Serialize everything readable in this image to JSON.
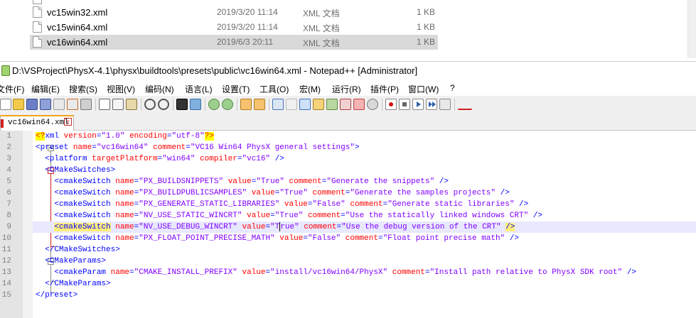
{
  "explorer": {
    "files": [
      {
        "name": "",
        "date": "",
        "type": "",
        "size": ""
      },
      {
        "name": "vc15win32.xml",
        "date": "2019/3/20 11:14",
        "type": "XML 文档",
        "size": "1 KB"
      },
      {
        "name": "vc15win64.xml",
        "date": "2019/3/20 11:14",
        "type": "XML 文档",
        "size": "1 KB"
      },
      {
        "name": "vc16win64.xml",
        "date": "2019/6/3 20:11",
        "type": "XML 文档",
        "size": "1 KB"
      }
    ]
  },
  "window": {
    "title": "D:\\VSProject\\PhysX-4.1\\physx\\buildtools\\presets\\public\\vc16win64.xml - Notepad++ [Administrator]"
  },
  "menu": [
    "文件(F)",
    "编辑(E)",
    "搜索(S)",
    "视图(V)",
    "编码(N)",
    "语言(L)",
    "设置(T)",
    "工具(O)",
    "宏(M)",
    "运行(R)",
    "插件(P)",
    "窗口(W)",
    "?"
  ],
  "toolbar_icons": [
    "new-file-icon",
    "open-file-icon",
    "save-icon",
    "save-all-icon",
    "close-icon",
    "close-all-icon",
    "print-icon",
    "cut-icon",
    "copy-icon",
    "paste-icon",
    "undo-icon",
    "redo-icon",
    "find-icon",
    "replace-icon",
    "zoom-in-icon",
    "zoom-out-icon",
    "sync-v-icon",
    "sync-h-icon",
    "wrap-icon",
    "all-chars-icon",
    "indent-guide-icon",
    "lang-icon",
    "doc-map-icon",
    "function-list-icon",
    "folder-workspace-icon",
    "monitor-icon",
    "record-macro-icon",
    "stop-macro-icon",
    "play-macro-icon",
    "run-macro-multiple-icon",
    "save-macro-icon",
    "spellcheck-icon"
  ],
  "tab": {
    "label": "vc16win64.xml"
  },
  "editor": {
    "line_numbers": [
      "1",
      "2",
      "3",
      "4",
      "5",
      "6",
      "7",
      "8",
      "9",
      "10",
      "11",
      "12",
      "13",
      "14",
      "15"
    ],
    "highlighted_line": 9,
    "lines": [
      {
        "indent": "",
        "parts": [
          {
            "c": "pi",
            "t": "<?"
          },
          {
            "c": "t",
            "t": "xml "
          },
          {
            "c": "a",
            "t": "version"
          },
          {
            "c": "t",
            "t": "="
          },
          {
            "c": "v",
            "t": "\"1.0\""
          },
          {
            "c": "t",
            "t": " "
          },
          {
            "c": "a",
            "t": "encoding"
          },
          {
            "c": "t",
            "t": "="
          },
          {
            "c": "v",
            "t": "\"utf-8\""
          },
          {
            "c": "pi",
            "t": "?>"
          }
        ]
      },
      {
        "indent": "",
        "parts": [
          {
            "c": "t",
            "t": "<preset "
          },
          {
            "c": "a",
            "t": "name"
          },
          {
            "c": "t",
            "t": "="
          },
          {
            "c": "v",
            "t": "\"vc16win64\""
          },
          {
            "c": "t",
            "t": " "
          },
          {
            "c": "a",
            "t": "comment"
          },
          {
            "c": "t",
            "t": "="
          },
          {
            "c": "v",
            "t": "\"VC16 Win64 PhysX general settings\""
          },
          {
            "c": "t",
            "t": ">"
          }
        ]
      },
      {
        "indent": "  ",
        "parts": [
          {
            "c": "t",
            "t": "<platform "
          },
          {
            "c": "a",
            "t": "targetPlatform"
          },
          {
            "c": "t",
            "t": "="
          },
          {
            "c": "v",
            "t": "\"win64\""
          },
          {
            "c": "t",
            "t": " "
          },
          {
            "c": "a",
            "t": "compiler"
          },
          {
            "c": "t",
            "t": "="
          },
          {
            "c": "v",
            "t": "\"vc16\""
          },
          {
            "c": "t",
            "t": " />"
          }
        ]
      },
      {
        "indent": "  ",
        "parts": [
          {
            "c": "t",
            "t": "<CMakeSwitches>"
          }
        ]
      },
      {
        "indent": "    ",
        "parts": [
          {
            "c": "t",
            "t": "<cmakeSwitch "
          },
          {
            "c": "a",
            "t": "name"
          },
          {
            "c": "t",
            "t": "="
          },
          {
            "c": "v",
            "t": "\"PX_BUILDSNIPPETS\""
          },
          {
            "c": "t",
            "t": " "
          },
          {
            "c": "a",
            "t": "value"
          },
          {
            "c": "t",
            "t": "="
          },
          {
            "c": "v",
            "t": "\"True\""
          },
          {
            "c": "t",
            "t": " "
          },
          {
            "c": "a",
            "t": "comment"
          },
          {
            "c": "t",
            "t": "="
          },
          {
            "c": "v",
            "t": "\"Generate the snippets\""
          },
          {
            "c": "t",
            "t": " />"
          }
        ]
      },
      {
        "indent": "    ",
        "parts": [
          {
            "c": "t",
            "t": "<cmakeSwitch "
          },
          {
            "c": "a",
            "t": "name"
          },
          {
            "c": "t",
            "t": "="
          },
          {
            "c": "v",
            "t": "\"PX_BUILDPUBLICSAMPLES\""
          },
          {
            "c": "t",
            "t": " "
          },
          {
            "c": "a",
            "t": "value"
          },
          {
            "c": "t",
            "t": "="
          },
          {
            "c": "v",
            "t": "\"True\""
          },
          {
            "c": "t",
            "t": " "
          },
          {
            "c": "a",
            "t": "comment"
          },
          {
            "c": "t",
            "t": "="
          },
          {
            "c": "v",
            "t": "\"Generate the samples projects\""
          },
          {
            "c": "t",
            "t": " />"
          }
        ]
      },
      {
        "indent": "    ",
        "parts": [
          {
            "c": "t",
            "t": "<cmakeSwitch "
          },
          {
            "c": "a",
            "t": "name"
          },
          {
            "c": "t",
            "t": "="
          },
          {
            "c": "v",
            "t": "\"PX_GENERATE_STATIC_LIBRARIES\""
          },
          {
            "c": "t",
            "t": " "
          },
          {
            "c": "a",
            "t": "value"
          },
          {
            "c": "t",
            "t": "="
          },
          {
            "c": "v",
            "t": "\"False\""
          },
          {
            "c": "t",
            "t": " "
          },
          {
            "c": "a",
            "t": "comment"
          },
          {
            "c": "t",
            "t": "="
          },
          {
            "c": "v",
            "t": "\"Generate static libraries\""
          },
          {
            "c": "t",
            "t": " />"
          }
        ]
      },
      {
        "indent": "    ",
        "parts": [
          {
            "c": "t",
            "t": "<cmakeSwitch "
          },
          {
            "c": "a",
            "t": "name"
          },
          {
            "c": "t",
            "t": "="
          },
          {
            "c": "v",
            "t": "\"NV_USE_STATIC_WINCRT\""
          },
          {
            "c": "t",
            "t": " "
          },
          {
            "c": "a",
            "t": "value"
          },
          {
            "c": "t",
            "t": "="
          },
          {
            "c": "v",
            "t": "\"True\""
          },
          {
            "c": "t",
            "t": " "
          },
          {
            "c": "a",
            "t": "comment"
          },
          {
            "c": "t",
            "t": "="
          },
          {
            "c": "v",
            "t": "\"Use the statically linked windows CRT\""
          },
          {
            "c": "t",
            "t": " />"
          }
        ]
      },
      {
        "indent": "    ",
        "parts": [
          {
            "c": "t hl-tag",
            "t": "<cmakeSwitch"
          },
          {
            "c": "t",
            "t": " "
          },
          {
            "c": "a",
            "t": "name"
          },
          {
            "c": "t",
            "t": "="
          },
          {
            "c": "v",
            "t": "\"NV_USE_DEBUG_WINCRT\""
          },
          {
            "c": "t",
            "t": " "
          },
          {
            "c": "a",
            "t": "value"
          },
          {
            "c": "t",
            "t": "="
          },
          {
            "c": "v",
            "t": "\"T"
          },
          {
            "c": "caret",
            "t": ""
          },
          {
            "c": "v",
            "t": "rue\""
          },
          {
            "c": "t",
            "t": " "
          },
          {
            "c": "a",
            "t": "comment"
          },
          {
            "c": "t",
            "t": "="
          },
          {
            "c": "v",
            "t": "\"Use the debug version of the CRT\""
          },
          {
            "c": "t",
            "t": " "
          },
          {
            "c": "t hl-tag",
            "t": "/>"
          }
        ]
      },
      {
        "indent": "    ",
        "parts": [
          {
            "c": "t",
            "t": "<cmakeSwitch "
          },
          {
            "c": "a",
            "t": "name"
          },
          {
            "c": "t",
            "t": "="
          },
          {
            "c": "v",
            "t": "\"PX_FLOAT_POINT_PRECISE_MATH\""
          },
          {
            "c": "t",
            "t": " "
          },
          {
            "c": "a",
            "t": "value"
          },
          {
            "c": "t",
            "t": "="
          },
          {
            "c": "v",
            "t": "\"False\""
          },
          {
            "c": "t",
            "t": " "
          },
          {
            "c": "a",
            "t": "comment"
          },
          {
            "c": "t",
            "t": "="
          },
          {
            "c": "v",
            "t": "\"Float point precise math\""
          },
          {
            "c": "t",
            "t": " />"
          }
        ]
      },
      {
        "indent": "  ",
        "parts": [
          {
            "c": "t",
            "t": "</CMakeSwitches>"
          }
        ]
      },
      {
        "indent": "  ",
        "parts": [
          {
            "c": "t",
            "t": "<CMakeParams>"
          }
        ]
      },
      {
        "indent": "    ",
        "parts": [
          {
            "c": "t",
            "t": "<cmakeParam "
          },
          {
            "c": "a",
            "t": "name"
          },
          {
            "c": "t",
            "t": "="
          },
          {
            "c": "v",
            "t": "\"CMAKE_INSTALL_PREFIX\""
          },
          {
            "c": "t",
            "t": " "
          },
          {
            "c": "a",
            "t": "value"
          },
          {
            "c": "t",
            "t": "="
          },
          {
            "c": "v",
            "t": "\"install/vc16win64/PhysX\""
          },
          {
            "c": "t",
            "t": " "
          },
          {
            "c": "a",
            "t": "comment"
          },
          {
            "c": "t",
            "t": "="
          },
          {
            "c": "v",
            "t": "\"Install path relative to PhysX SDK root\""
          },
          {
            "c": "t",
            "t": " />"
          }
        ]
      },
      {
        "indent": "  ",
        "parts": [
          {
            "c": "t",
            "t": "</CMakeParams>"
          }
        ]
      },
      {
        "indent": "",
        "parts": [
          {
            "c": "t",
            "t": "</preset>"
          }
        ]
      }
    ]
  },
  "colors": {
    "tag": "#0000ff",
    "attr": "#ff0000",
    "value": "#8000ff",
    "current_line": "#e8e8ff",
    "tab_accent": "#f6a21b"
  }
}
